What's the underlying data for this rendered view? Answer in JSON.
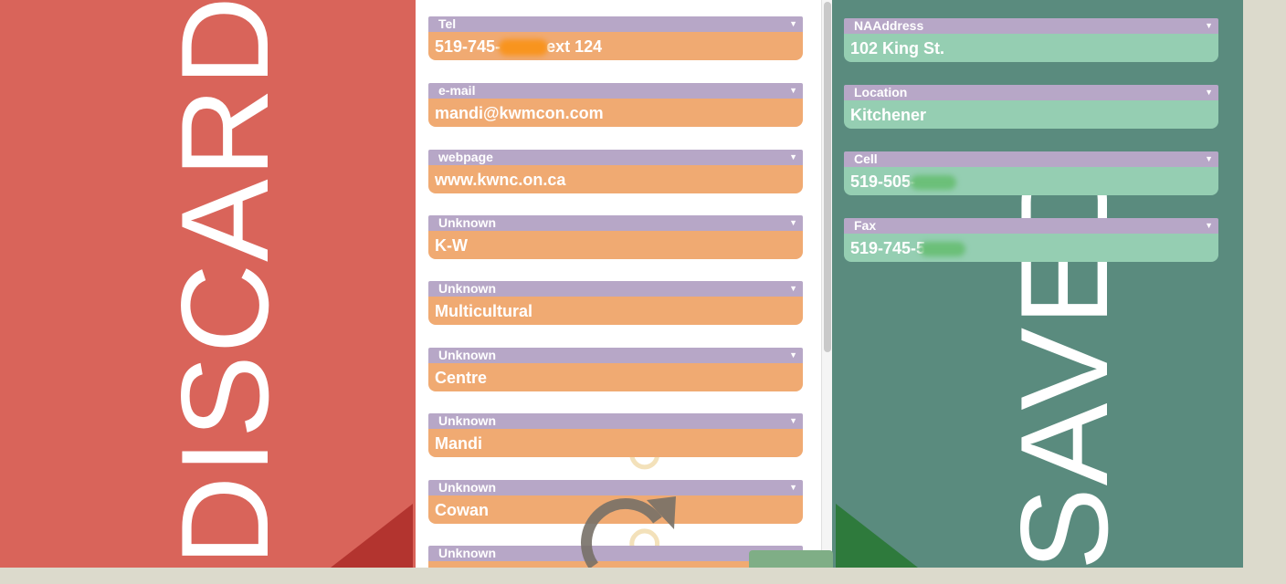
{
  "discard": {
    "label": "DISCARD"
  },
  "saved": {
    "label": "SAVED",
    "fields": [
      {
        "type": "NAAddress",
        "value": "102 King St."
      },
      {
        "type": "Location",
        "value": "Kitchener"
      },
      {
        "type": "Cell",
        "value": "519-505-"
      },
      {
        "type": "Fax",
        "value": "519-745-5"
      }
    ]
  },
  "unsorted": {
    "fields": [
      {
        "type": "Tel",
        "value_before": "519-745-",
        "value_after": "ext 124"
      },
      {
        "type": "e-mail",
        "value": "mandi@kwmcon.com"
      },
      {
        "type": "webpage",
        "value": "www.kwnc.on.ca"
      },
      {
        "type": "Unknown",
        "value": "K-W"
      },
      {
        "type": "Unknown",
        "value": "Multicultural"
      },
      {
        "type": "Unknown",
        "value": "Centre"
      },
      {
        "type": "Unknown",
        "value": "Mandi"
      },
      {
        "type": "Unknown",
        "value": "Cowan"
      },
      {
        "type": "Unknown",
        "value": ""
      }
    ]
  },
  "icons": {
    "dropdown": "chevron-down-icon",
    "refresh": "refresh-icon"
  },
  "colors": {
    "discard_bg": "#d9645a",
    "saved_bg": "#5a8b7e",
    "label_bar": "#b7a7c7",
    "unsorted_value": "#f0aa72",
    "saved_value": "#95ceb2"
  }
}
